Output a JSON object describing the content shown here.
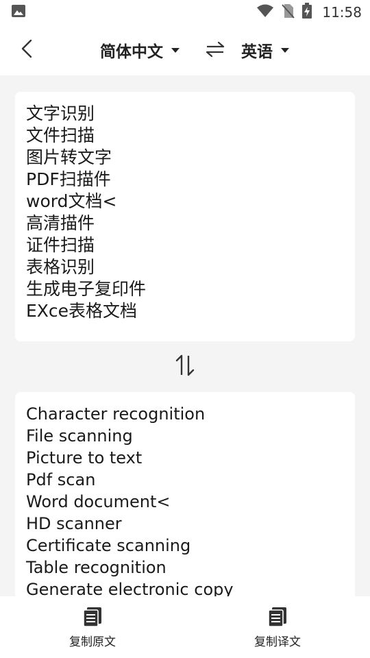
{
  "status_bar": {
    "time": "11:58",
    "icons": [
      "image-icon",
      "wifi-icon",
      "no-sim-icon",
      "battery-charging-icon"
    ]
  },
  "header": {
    "back_icon": "chevron-left-icon",
    "source_language": "简体中文",
    "target_language": "英语",
    "swap_icon": "swap-horizontal-icon"
  },
  "source": {
    "lines": [
      "文字识别",
      "文件扫描",
      "图片转文字",
      "PDF扫描件",
      "word文档<",
      "高清描件",
      "证件扫描",
      "表格识别",
      "生成电子复印件",
      "EXce表格文档"
    ]
  },
  "middle": {
    "swap_icon": "swap-vertical-icon"
  },
  "translation": {
    "lines": [
      "Character recognition",
      "File scanning",
      "Picture to text",
      "Pdf scan",
      "Word document<",
      "HD scanner",
      "Certificate scanning",
      "Table recognition",
      "Generate electronic copy"
    ]
  },
  "bottom_bar": {
    "copy_source_label": "复制原文",
    "copy_translation_label": "复制译文",
    "icon": "document-copy-icon"
  },
  "colors": {
    "background": "#f4f4f4",
    "card": "#ffffff",
    "text": "#1a1a1a"
  }
}
